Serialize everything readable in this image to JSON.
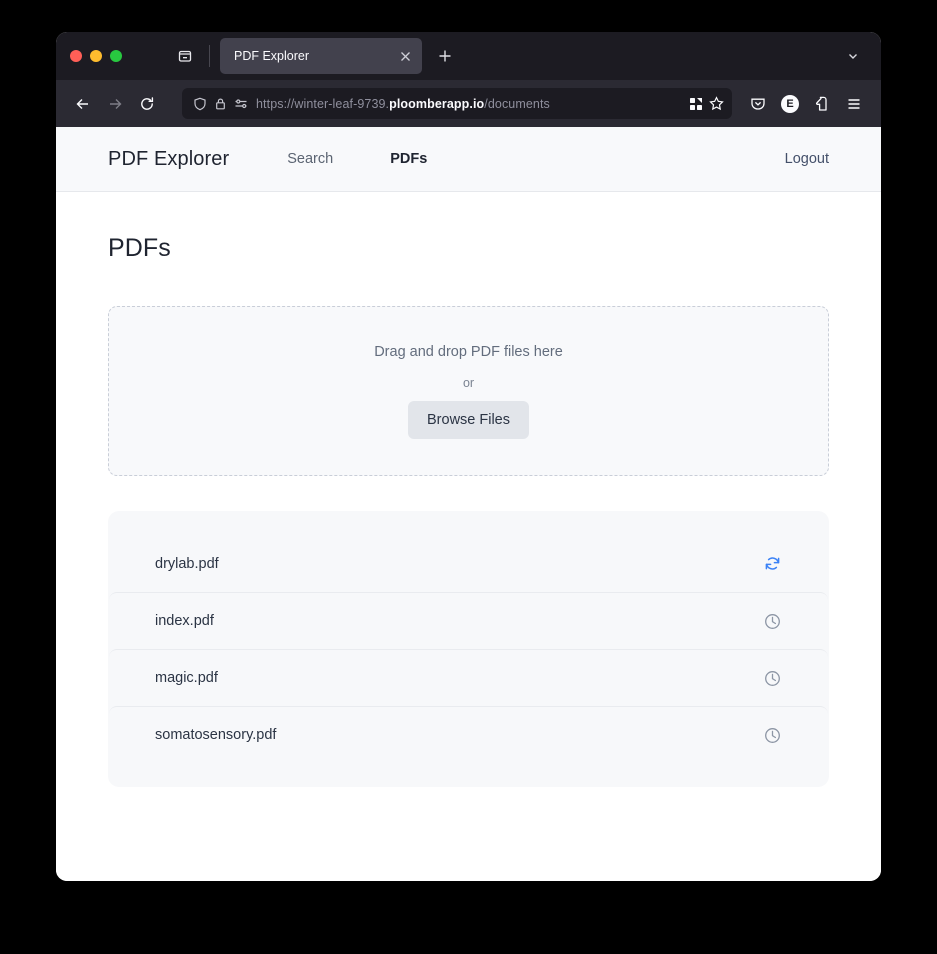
{
  "browser": {
    "traffic_lights": [
      "close",
      "minimize",
      "maximize"
    ],
    "tablist_icon": "tab-list-icon",
    "tabs": [
      {
        "title": "PDF Explorer",
        "close_icon": "close-icon",
        "active": true
      }
    ],
    "new_tab_icon": "plus-icon",
    "tab_overflow_icon": "chevron-down-icon",
    "toolbar": {
      "back_icon": "back-arrow-icon",
      "forward_icon": "forward-arrow-icon",
      "reload_icon": "reload-icon",
      "shield_icon": "shield-icon",
      "lock_icon": "lock-icon",
      "permissions_icon": "tracking-settings-icon",
      "url_prefix": "https://winter-leaf-9739.",
      "url_domain": "ploomberapp.io",
      "url_path": "/documents",
      "url_full": "https://winter-leaf-9739.ploomberapp.io/documents",
      "extensions_icon": "puzzle-grid-icon",
      "bookmark_icon": "star-icon",
      "pocket_icon": "pocket-icon",
      "account_initial": "E",
      "addons_icon": "extensions-icon",
      "menu_icon": "hamburger-menu-icon"
    }
  },
  "app": {
    "brand": "PDF Explorer",
    "nav": [
      {
        "label": "Search",
        "active": false
      },
      {
        "label": "PDFs",
        "active": true
      }
    ],
    "logout_label": "Logout",
    "page_title": "PDFs",
    "dropzone": {
      "prompt": "Drag and drop PDF files here",
      "or_label": "or",
      "browse_label": "Browse Files"
    },
    "files": [
      {
        "name": "drylab.pdf",
        "status_icon": "sync-icon",
        "status": "syncing"
      },
      {
        "name": "index.pdf",
        "status_icon": "clock-icon",
        "status": "pending"
      },
      {
        "name": "magic.pdf",
        "status_icon": "clock-icon",
        "status": "pending"
      },
      {
        "name": "somatosensory.pdf",
        "status_icon": "clock-icon",
        "status": "pending"
      }
    ]
  },
  "colors": {
    "accent_blue": "#3b82f6",
    "status_gray": "#8d96a5",
    "chrome_dark": "#2b2a33",
    "tabstrip_dark": "#1c1b22",
    "page_bg": "#ffffff",
    "panel_bg": "#f7f8fa"
  }
}
